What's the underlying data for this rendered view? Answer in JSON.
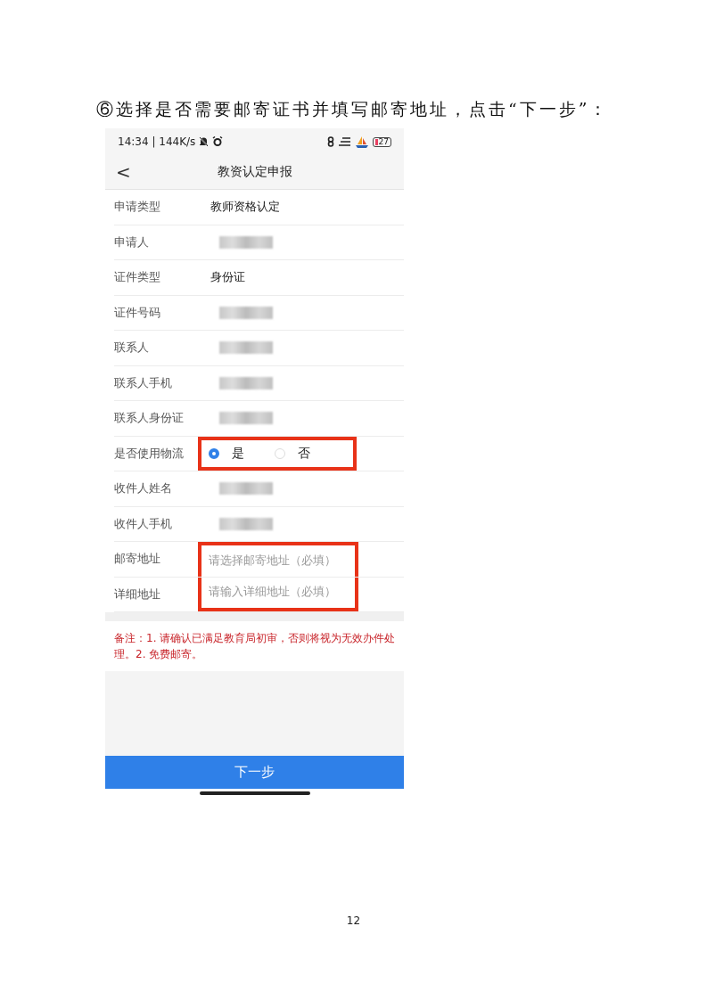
{
  "instruction": "⑥选择是否需要邮寄证书并填写邮寄地址，点击“下一步”：",
  "status_bar": {
    "time": "14:34 | 144K/s",
    "battery": "27"
  },
  "header": {
    "back": "<",
    "title": "教资认定申报"
  },
  "rows": [
    {
      "label": "申请类型",
      "kind": "text",
      "value": "教师资格认定",
      "highlighted": false
    },
    {
      "label": "申请人",
      "kind": "redacted",
      "highlighted": false
    },
    {
      "label": "证件类型",
      "kind": "text",
      "value": "身份证",
      "highlighted": false
    },
    {
      "label": "证件号码",
      "kind": "redacted",
      "highlighted": false
    },
    {
      "label": "联系人",
      "kind": "redacted",
      "highlighted": false
    },
    {
      "label": "联系人手机",
      "kind": "redacted",
      "highlighted": false
    },
    {
      "label": "联系人身份证",
      "kind": "redacted",
      "highlighted": false
    },
    {
      "label": "是否使用物流",
      "kind": "radio",
      "options": [
        {
          "label": "是",
          "selected": true
        },
        {
          "label": "否",
          "selected": false
        }
      ],
      "highlighted": true
    },
    {
      "label": "收件人姓名",
      "kind": "redacted",
      "highlighted": false
    },
    {
      "label": "收件人手机",
      "kind": "redacted",
      "highlighted": false
    },
    {
      "label": "邮寄地址",
      "kind": "input",
      "placeholder": "请选择邮寄地址（必填）",
      "highlighted": true
    },
    {
      "label": "详细地址",
      "kind": "input",
      "placeholder": "请输入详细地址（必填）",
      "highlighted": true
    }
  ],
  "note": "备注：1. 请确认已满足教育局初审，否则将视为无效办件处理。2. 免费邮寄。",
  "next_button": "下一步",
  "page_number": "12"
}
